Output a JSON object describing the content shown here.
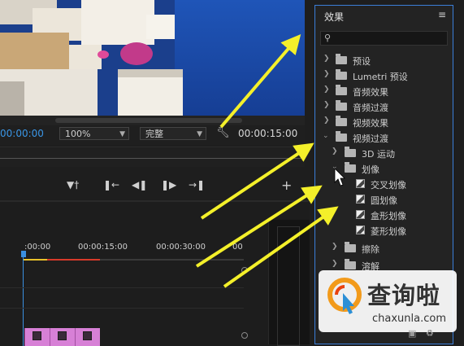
{
  "monitor": {
    "timecode_current": "00:00:00",
    "zoom": "100%",
    "quality": "完整",
    "timecode_duration": "00:00:15:00"
  },
  "timeline": {
    "ruler_labels": [
      ":00:00",
      "00:00:15:00",
      "00:00:30:00",
      "00"
    ]
  },
  "effects_panel": {
    "title": "效果",
    "menu_icon": "hamburger-icon",
    "search_icon": "search-icon",
    "items": [
      {
        "label": "预设",
        "type": "folder-special",
        "expanded": false,
        "level": 0
      },
      {
        "label": "Lumetri 预设",
        "type": "folder-special",
        "expanded": false,
        "level": 0
      },
      {
        "label": "音频效果",
        "type": "folder",
        "expanded": false,
        "level": 0
      },
      {
        "label": "音频过渡",
        "type": "folder",
        "expanded": false,
        "level": 0
      },
      {
        "label": "视频效果",
        "type": "folder",
        "expanded": false,
        "level": 0
      },
      {
        "label": "视频过渡",
        "type": "folder",
        "expanded": true,
        "level": 0
      },
      {
        "label": "3D 运动",
        "type": "folder",
        "expanded": false,
        "level": 1
      },
      {
        "label": "划像",
        "type": "folder",
        "expanded": true,
        "level": 1
      },
      {
        "label": "交叉划像",
        "type": "effect",
        "level": 2
      },
      {
        "label": "圆划像",
        "type": "effect",
        "level": 2
      },
      {
        "label": "盒形划像",
        "type": "effect",
        "level": 2
      },
      {
        "label": "菱形划像",
        "type": "effect",
        "level": 2
      },
      {
        "label": "擦除",
        "type": "folder",
        "expanded": false,
        "level": 1
      },
      {
        "label": "溶解",
        "type": "folder",
        "expanded": false,
        "level": 1
      }
    ]
  },
  "watermark": {
    "brand": "查询啦",
    "domain": "chaxunla.com"
  },
  "colors": {
    "accent_blue": "#3a96e6",
    "panel_border": "#3b7ed8",
    "clip_pink": "#d780d6",
    "arrow_yellow": "#f4f02a"
  }
}
